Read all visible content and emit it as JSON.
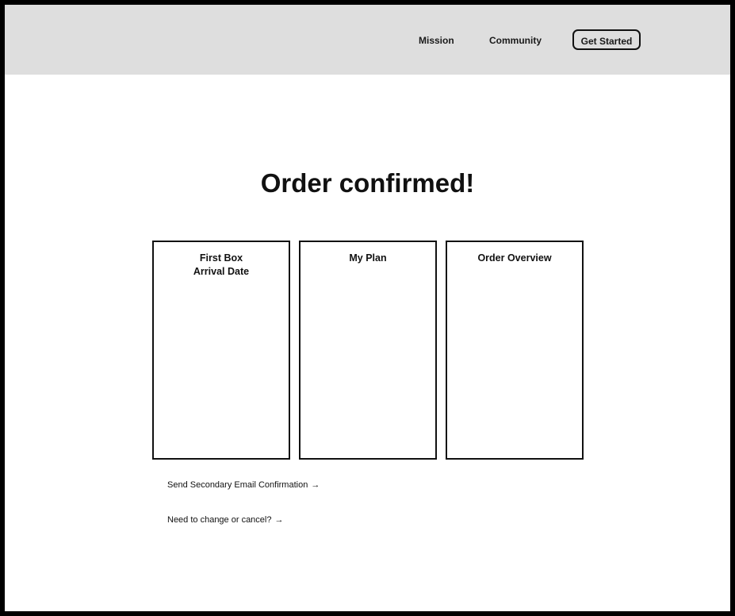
{
  "nav": {
    "links": [
      {
        "label": "Mission"
      },
      {
        "label": "Community"
      }
    ],
    "cta_label": "Get Started"
  },
  "main": {
    "title": "Order confirmed!",
    "cards": [
      {
        "title": "First Box\nArrival Date"
      },
      {
        "title": "My Plan"
      },
      {
        "title": "Order Overview"
      }
    ],
    "links": [
      {
        "label": "Send Secondary Email Confirmation",
        "icon": "arrow-right-icon",
        "glyph": "→"
      },
      {
        "label": "Need to change or cancel?",
        "icon": "arrow-right-icon",
        "glyph": "→"
      }
    ]
  }
}
